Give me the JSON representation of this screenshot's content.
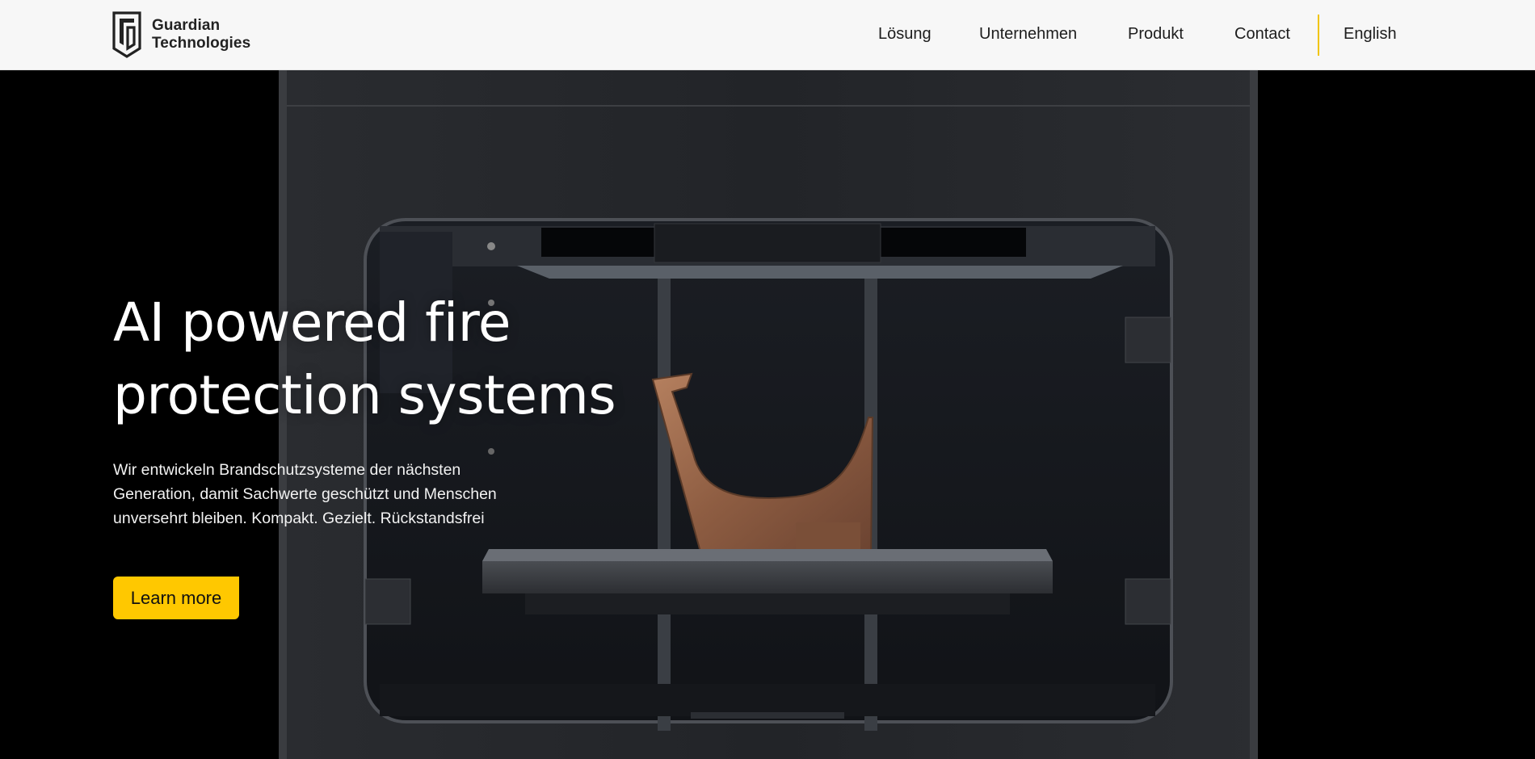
{
  "brand": {
    "line1": "Guardian",
    "line2": "Technologies",
    "logo_icon": "guardian-shield-logo"
  },
  "nav": {
    "items": [
      {
        "label": "Lösung"
      },
      {
        "label": "Unternehmen"
      },
      {
        "label": "Produkt"
      },
      {
        "label": "Contact"
      }
    ],
    "language": "English",
    "accent": "#f1c400"
  },
  "hero": {
    "title_line1": "AI powered fire",
    "title_line2": "protection systems",
    "description": "Wir entwickeln Brandschutzsysteme der nächsten Generation, damit Sachwerte geschützt und Menschen unversehrt bleiben. Kompakt. Gezielt. Rückstandsfrei",
    "cta_label": "Learn more",
    "cta_color": "#ffc800",
    "background_image": "3D printer with copper part"
  }
}
